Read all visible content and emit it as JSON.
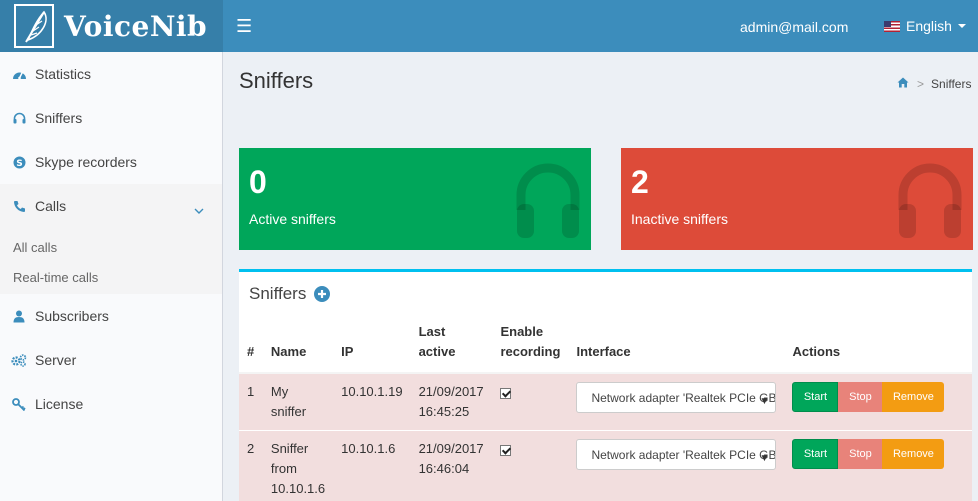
{
  "app": {
    "name": "VoiceNib"
  },
  "header": {
    "user_email": "admin@mail.com",
    "language": "English"
  },
  "sidebar": {
    "items": [
      {
        "label": "Statistics",
        "icon": "dashboard-icon"
      },
      {
        "label": "Sniffers",
        "icon": "headphones-icon"
      },
      {
        "label": "Skype recorders",
        "icon": "skype-icon"
      },
      {
        "label": "Calls",
        "icon": "phone-icon",
        "expanded": true
      },
      {
        "label": "Subscribers",
        "icon": "user-icon"
      },
      {
        "label": "Server",
        "icon": "cogs-icon"
      },
      {
        "label": "License",
        "icon": "key-icon"
      }
    ],
    "calls_sub": [
      {
        "label": "All calls"
      },
      {
        "label": "Real-time calls"
      }
    ]
  },
  "page": {
    "title": "Sniffers",
    "breadcrumb_current": "Sniffers"
  },
  "stats": {
    "active": {
      "count": "0",
      "label": "Active sniffers",
      "color": "#00a65a"
    },
    "inactive": {
      "count": "2",
      "label": "Inactive sniffers",
      "color": "#dd4b39"
    }
  },
  "table": {
    "title": "Sniffers",
    "headers": {
      "num": "#",
      "name": "Name",
      "ip": "IP",
      "last_active": "Last active",
      "enable_recording": "Enable recording",
      "interface": "Interface",
      "actions": "Actions"
    },
    "rows": [
      {
        "num": "1",
        "name": "My sniffer",
        "ip": "10.10.1.19",
        "last_active": "21/09/2017 16:45:25",
        "recording": true,
        "interface": "Network adapter 'Realtek PCIe GBE Family Controller'"
      },
      {
        "num": "2",
        "name": "Sniffer from 10.10.1.6",
        "ip": "10.10.1.6",
        "last_active": "21/09/2017 16:46:04",
        "recording": true,
        "interface": "Network adapter 'Realtek PCIe GBE Family Controller'"
      }
    ],
    "buttons": {
      "start": "Start",
      "stop": "Stop",
      "remove": "Remove"
    }
  }
}
